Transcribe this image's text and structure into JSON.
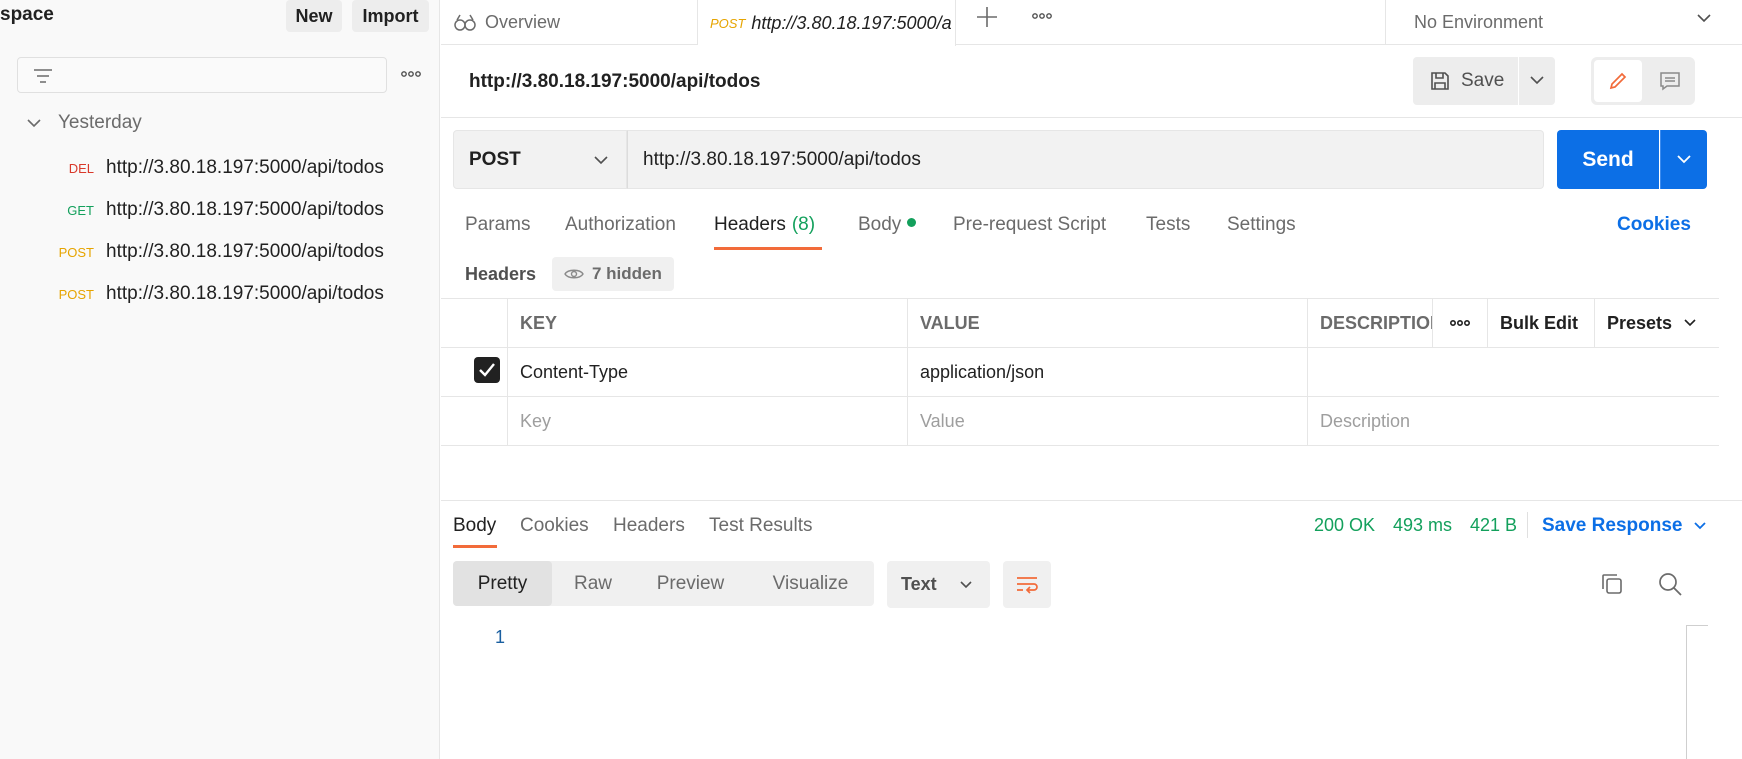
{
  "workspace": {
    "title": "space",
    "new_label": "New",
    "import_label": "Import"
  },
  "sidebar": {
    "group_label": "Yesterday",
    "history": [
      {
        "method": "DEL",
        "url": "http://3.80.18.197:5000/api/todos"
      },
      {
        "method": "GET",
        "url": "http://3.80.18.197:5000/api/todos"
      },
      {
        "method": "POST",
        "url": "http://3.80.18.197:5000/api/todos"
      },
      {
        "method": "POST",
        "url": "http://3.80.18.197:5000/api/todos"
      }
    ]
  },
  "tabs": {
    "overview_label": "Overview",
    "active_method": "POST",
    "active_url": "http://3.80.18.197:5000/a"
  },
  "environment": {
    "selected": "No Environment"
  },
  "request": {
    "title": "http://3.80.18.197:5000/api/todos",
    "save_label": "Save",
    "method": "POST",
    "url": "http://3.80.18.197:5000/api/todos",
    "send_label": "Send",
    "tabs": {
      "params": "Params",
      "authorization": "Authorization",
      "headers": "Headers",
      "headers_count": "(8)",
      "body": "Body",
      "prerequest": "Pre-request Script",
      "tests": "Tests",
      "settings": "Settings"
    },
    "cookies_label": "Cookies",
    "headers_label": "Headers",
    "hidden_label": "7 hidden"
  },
  "headers_table": {
    "col_key": "KEY",
    "col_value": "VALUE",
    "col_description": "DESCRIPTION",
    "bulk_edit": "Bulk Edit",
    "presets": "Presets",
    "rows": [
      {
        "checked": true,
        "key": "Content-Type",
        "value": "application/json",
        "description": ""
      }
    ],
    "placeholder_key": "Key",
    "placeholder_value": "Value",
    "placeholder_description": "Description"
  },
  "response": {
    "tabs": {
      "body": "Body",
      "cookies": "Cookies",
      "headers": "Headers",
      "test_results": "Test Results"
    },
    "status": "200 OK",
    "time": "493 ms",
    "size": "421 B",
    "save_response": "Save Response",
    "formats": {
      "pretty": "Pretty",
      "raw": "Raw",
      "preview": "Preview",
      "visualize": "Visualize"
    },
    "text_select": "Text",
    "line_number": "1"
  },
  "colors": {
    "accent": "#f26b3a",
    "primary": "#0c6fe6",
    "success": "#13a05c",
    "delete": "#d9392b",
    "post": "#e6a400"
  }
}
